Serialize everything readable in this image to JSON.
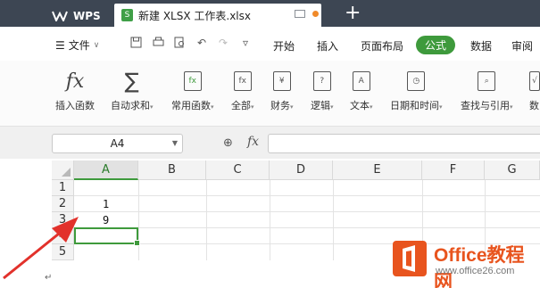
{
  "titlebar": {
    "app_name": "WPS",
    "doc_tab_title": "新建 XLSX 工作表.xlsx",
    "new_tab": "+"
  },
  "menu": {
    "file_label": "文件",
    "tabs": [
      "开始",
      "插入",
      "页面布局",
      "公式",
      "数据",
      "审阅"
    ],
    "active_tab": "公式"
  },
  "ribbon": {
    "buttons": [
      {
        "label": "插入函数",
        "icon": "fx-icon"
      },
      {
        "label": "自动求和",
        "icon": "sigma-icon"
      },
      {
        "label": "常用函数",
        "icon": "star-function-icon"
      },
      {
        "label": "全部",
        "icon": "function-book-icon"
      },
      {
        "label": "财务",
        "icon": "yen-book-icon"
      },
      {
        "label": "逻辑",
        "icon": "question-book-icon"
      },
      {
        "label": "文本",
        "icon": "text-book-icon"
      },
      {
        "label": "日期和时间",
        "icon": "clock-book-icon"
      },
      {
        "label": "查找与引用",
        "icon": "search-book-icon"
      },
      {
        "label": "数",
        "icon": "math-book-icon"
      }
    ]
  },
  "formula_bar": {
    "name_box": "A4",
    "fx": "fx",
    "content": ""
  },
  "grid": {
    "columns": [
      "A",
      "B",
      "C",
      "D",
      "E",
      "F",
      "G"
    ],
    "selected_column": "A",
    "rows": [
      "1",
      "2",
      "3",
      "4",
      "5"
    ],
    "cells": {
      "A2": "1",
      "A3": "9"
    },
    "active_cell": "A4"
  },
  "watermark": {
    "title": "Office教程网",
    "url": "www.office26.com"
  },
  "colors": {
    "accent": "#3e9a3c",
    "titlebar": "#3d4653",
    "arrow": "#e2312b",
    "watermark": "#e8541e"
  },
  "return_mark": "↵"
}
